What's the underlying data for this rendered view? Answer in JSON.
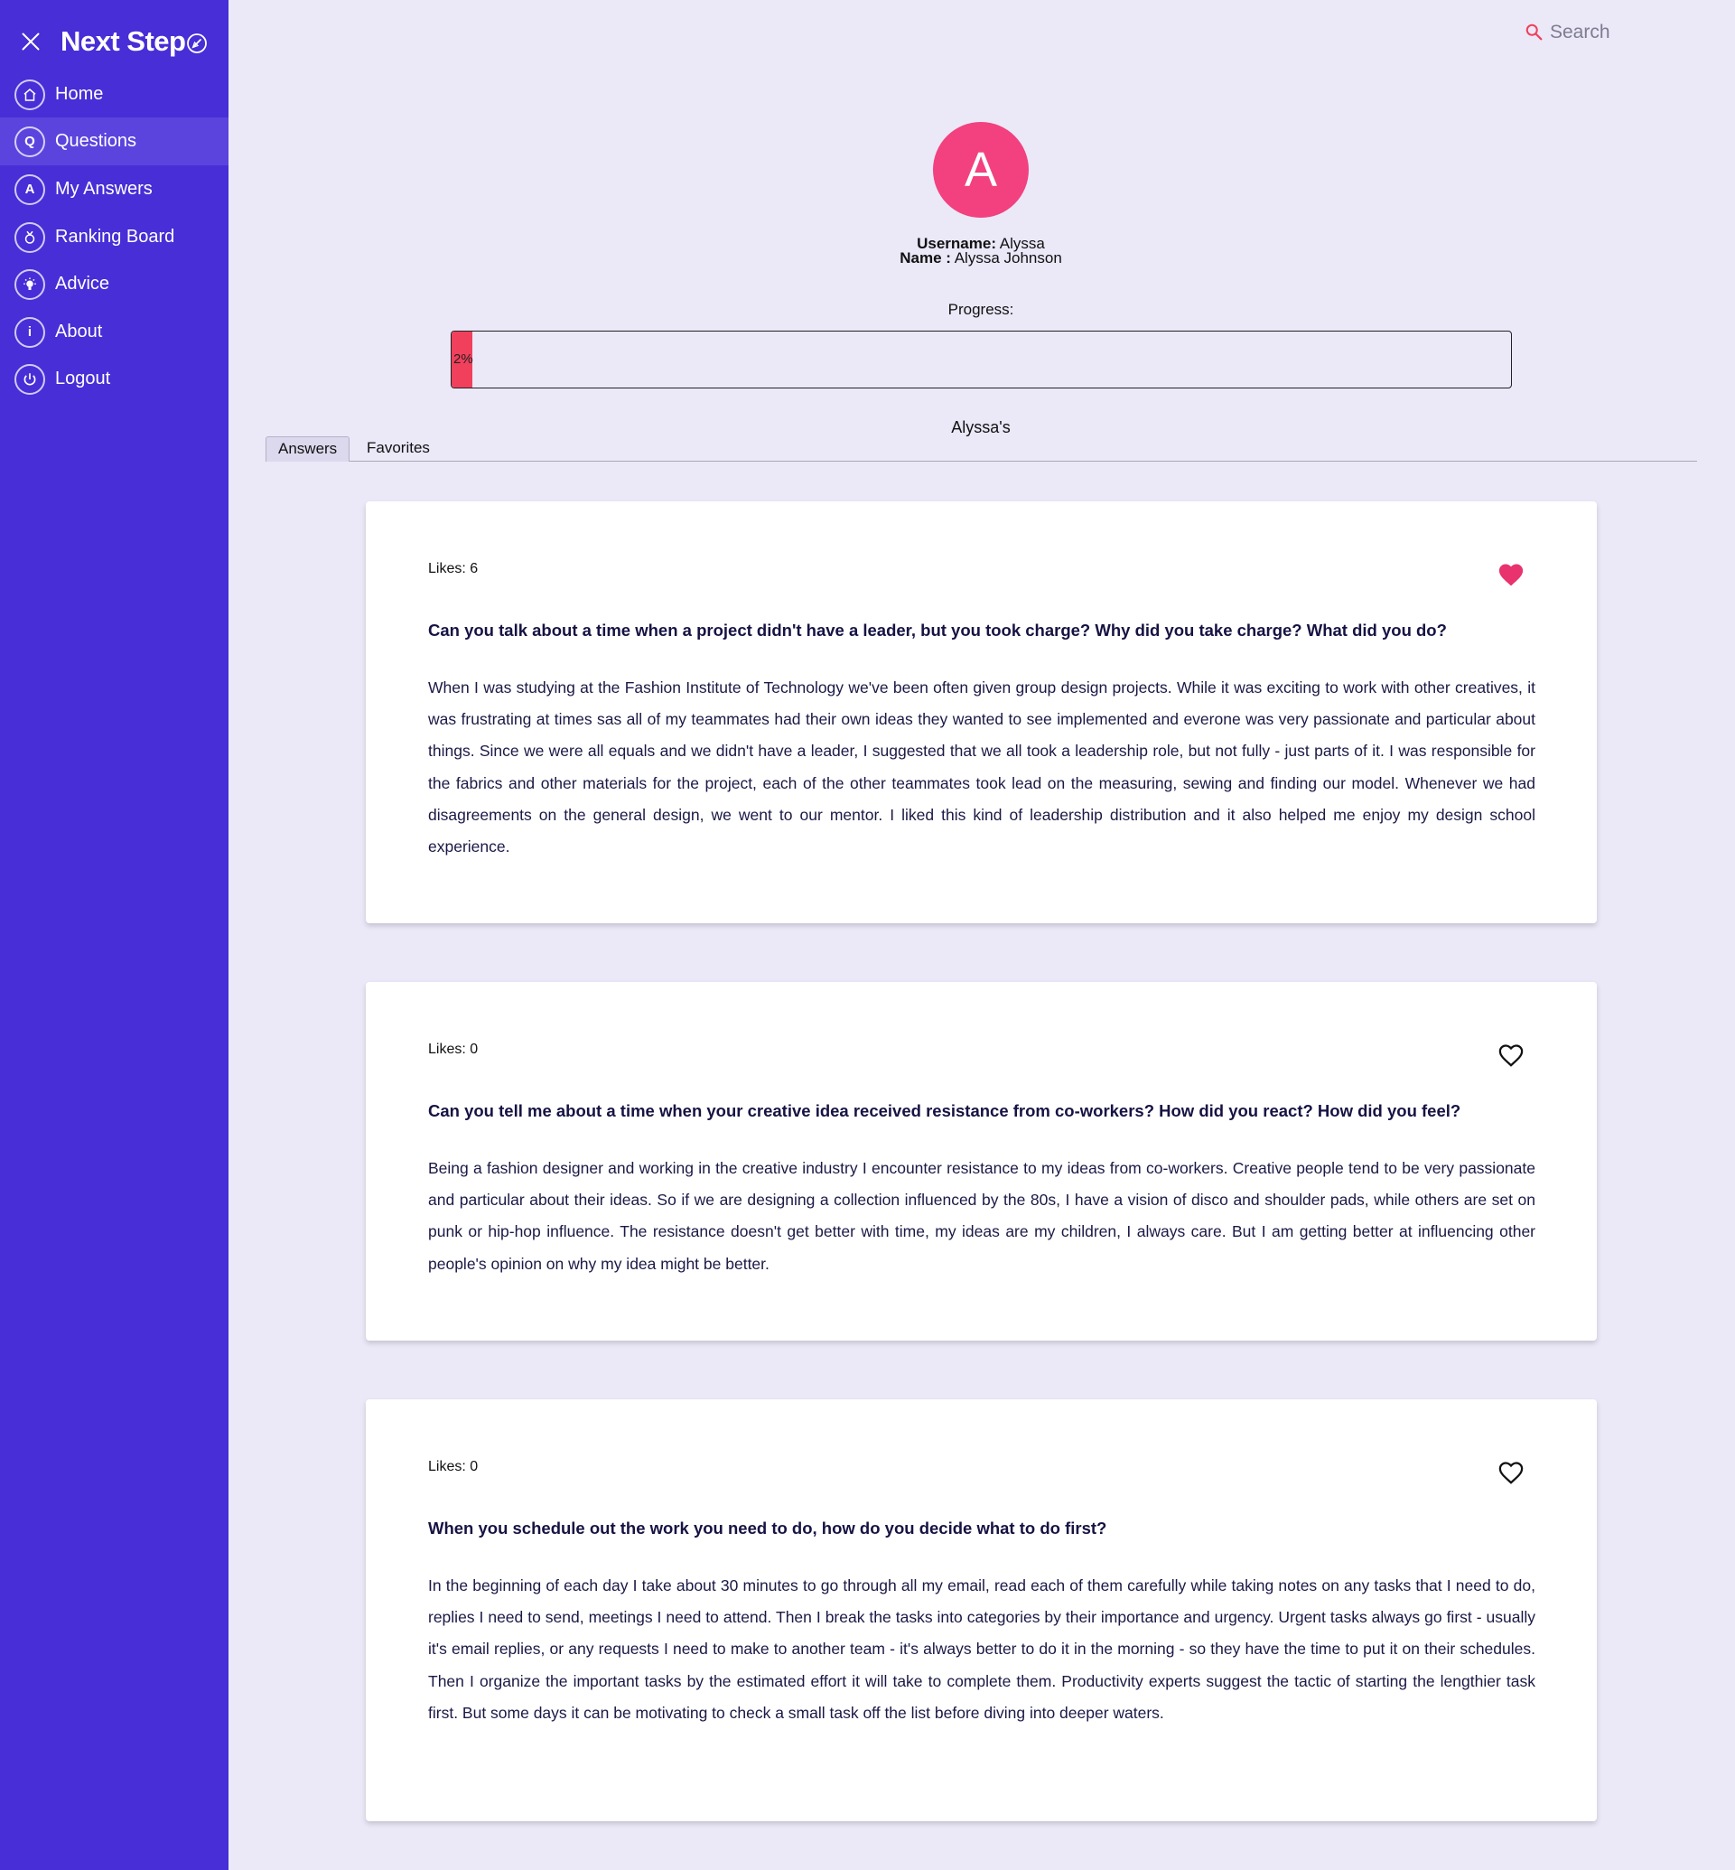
{
  "sidebar": {
    "brand": "Next Step",
    "items": [
      {
        "label": "Home",
        "icon": "home-icon",
        "active": false
      },
      {
        "label": "Questions",
        "icon": "questions-icon",
        "active": true
      },
      {
        "label": "My Answers",
        "icon": "my-answers-icon",
        "active": false
      },
      {
        "label": "Ranking Board",
        "icon": "ranking-icon",
        "active": false
      },
      {
        "label": "Advice",
        "icon": "advice-icon",
        "active": false
      },
      {
        "label": "About",
        "icon": "info-icon",
        "active": false
      },
      {
        "label": "Logout",
        "icon": "power-icon",
        "active": false
      }
    ],
    "color": "#472ed6"
  },
  "search": {
    "placeholder": "Search"
  },
  "profile": {
    "avatar_letter": "A",
    "avatar_color": "#f2417e",
    "username_label": "Username:",
    "username": "Alyssa",
    "name_label": "Name :",
    "name": "Alyssa Johnson",
    "progress_label": "Progress:",
    "progress_value": 0.02,
    "progress_text": "2%",
    "owner_label": "Alyssa's"
  },
  "tabs": [
    "Answers",
    "Favorites"
  ],
  "active_tab": "Answers",
  "answers": [
    {
      "likes": "Likes: 6",
      "liked": true,
      "question": "Can you talk about a time when a project didn't have a leader, but you took charge? Why did you take charge? What did you do?",
      "answer": "When I was studying at the Fashion Institute of Technology we've been often given group design projects. While it was exciting to work with other creatives, it was frustrating at times sas all of my teammates had their own ideas they wanted to see implemented and everone was very passionate and particular about things. Since we were all equals and we didn't have a leader, I suggested that we all took a leadership role, but not fully - just parts of it. I was responsible for the fabrics and other materials for the project, each of the other teammates took lead on the measuring, sewing and finding our model. Whenever we had disagreements on the general design, we went to our mentor. I liked this kind of leadership distribution and it also helped me enjoy my design school experience."
    },
    {
      "likes": "Likes: 0",
      "liked": false,
      "question": "Can you tell me about a time when your creative idea received resistance from co-workers? How did you react? How did you feel?",
      "answer": "Being a fashion designer and working in the creative industry I encounter resistance to my ideas from co-workers. Creative people tend to be very passionate and particular about their ideas. So if we are designing a collection influenced by the 80s, I have a vision of disco and shoulder pads, while others are set on punk or hip-hop influence. The resistance doesn't get better with time, my ideas are my children, I always care. But I am getting better at influencing other people's opinion on why my idea might be better."
    },
    {
      "likes": "Likes: 0",
      "liked": false,
      "question": "When you schedule out the work you need to do, how do you decide what to do first?",
      "answer": "In the beginning of each day I take about 30 minutes to go through all my email, read each of them carefully while taking notes on any tasks that I need to do, replies I need to send, meetings I need to attend. Then I break the tasks into categories by their importance and urgency. Urgent tasks always go first - usually it's email replies, or any requests I need to make to another team - it's always better to do it in the morning - so they have the time to put it on their schedules. Then I organize the important tasks by the estimated effort it will take to complete them. Productivity experts suggest the tactic of starting the lengthier task first. But some days it can be motivating to check a small task off the list before diving into deeper waters."
    }
  ],
  "colors": {
    "heart_filled": "#e8336e",
    "progress_fill": "#f0405c",
    "background": "#ebe8f8"
  }
}
